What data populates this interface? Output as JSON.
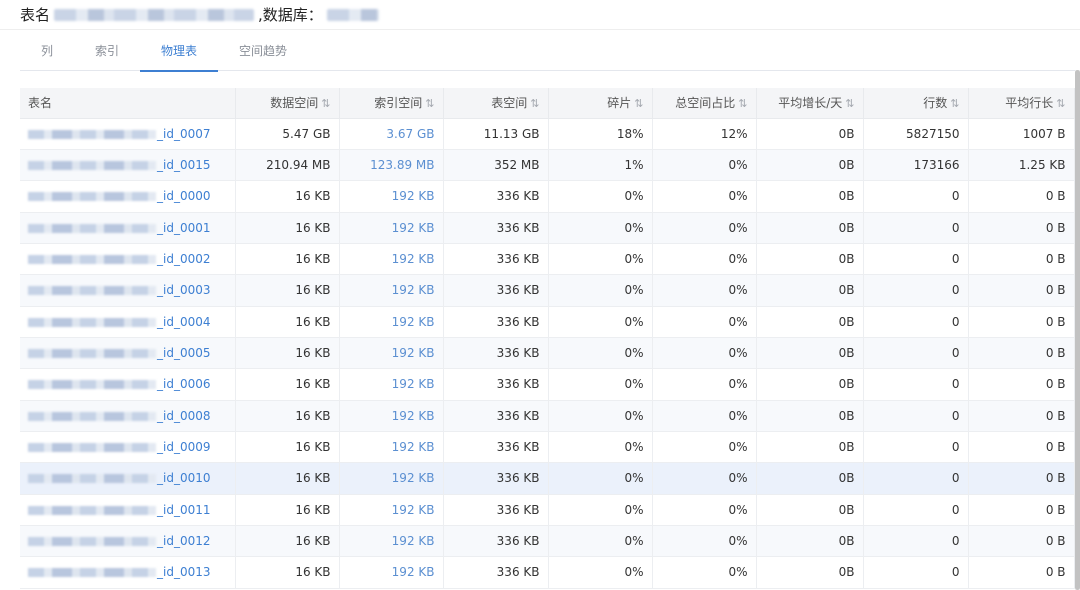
{
  "header": {
    "table_label": "表名",
    "db_label": ",数据库："
  },
  "tabs": [
    {
      "label": "列"
    },
    {
      "label": "索引"
    },
    {
      "label": "物理表",
      "active": true
    },
    {
      "label": "空间趋势"
    }
  ],
  "table": {
    "columns": [
      "表名",
      "数据空间",
      "索引空间",
      "表空间",
      "碎片",
      "总空间占比",
      "平均增长/天",
      "行数",
      "平均行长"
    ],
    "sort_icon": "⇅",
    "rows": [
      {
        "name": "_id_0007",
        "data": "5.47 GB",
        "index": "3.67 GB",
        "table": "11.13 GB",
        "frag": "18%",
        "ratio": "12%",
        "growth": "0B",
        "rows": "5827150",
        "avg": "1007 B"
      },
      {
        "name": "_id_0015",
        "data": "210.94 MB",
        "index": "123.89 MB",
        "table": "352 MB",
        "frag": "1%",
        "ratio": "0%",
        "growth": "0B",
        "rows": "173166",
        "avg": "1.25 KB"
      },
      {
        "name": "_id_0000",
        "data": "16 KB",
        "index": "192 KB",
        "table": "336 KB",
        "frag": "0%",
        "ratio": "0%",
        "growth": "0B",
        "rows": "0",
        "avg": "0 B"
      },
      {
        "name": "_id_0001",
        "data": "16 KB",
        "index": "192 KB",
        "table": "336 KB",
        "frag": "0%",
        "ratio": "0%",
        "growth": "0B",
        "rows": "0",
        "avg": "0 B"
      },
      {
        "name": "_id_0002",
        "data": "16 KB",
        "index": "192 KB",
        "table": "336 KB",
        "frag": "0%",
        "ratio": "0%",
        "growth": "0B",
        "rows": "0",
        "avg": "0 B"
      },
      {
        "name": "_id_0003",
        "data": "16 KB",
        "index": "192 KB",
        "table": "336 KB",
        "frag": "0%",
        "ratio": "0%",
        "growth": "0B",
        "rows": "0",
        "avg": "0 B"
      },
      {
        "name": "_id_0004",
        "data": "16 KB",
        "index": "192 KB",
        "table": "336 KB",
        "frag": "0%",
        "ratio": "0%",
        "growth": "0B",
        "rows": "0",
        "avg": "0 B"
      },
      {
        "name": "_id_0005",
        "data": "16 KB",
        "index": "192 KB",
        "table": "336 KB",
        "frag": "0%",
        "ratio": "0%",
        "growth": "0B",
        "rows": "0",
        "avg": "0 B"
      },
      {
        "name": "_id_0006",
        "data": "16 KB",
        "index": "192 KB",
        "table": "336 KB",
        "frag": "0%",
        "ratio": "0%",
        "growth": "0B",
        "rows": "0",
        "avg": "0 B"
      },
      {
        "name": "_id_0008",
        "data": "16 KB",
        "index": "192 KB",
        "table": "336 KB",
        "frag": "0%",
        "ratio": "0%",
        "growth": "0B",
        "rows": "0",
        "avg": "0 B"
      },
      {
        "name": "_id_0009",
        "data": "16 KB",
        "index": "192 KB",
        "table": "336 KB",
        "frag": "0%",
        "ratio": "0%",
        "growth": "0B",
        "rows": "0",
        "avg": "0 B"
      },
      {
        "name": "_id_0010",
        "data": "16 KB",
        "index": "192 KB",
        "table": "336 KB",
        "frag": "0%",
        "ratio": "0%",
        "growth": "0B",
        "rows": "0",
        "avg": "0 B",
        "highlight": true
      },
      {
        "name": "_id_0011",
        "data": "16 KB",
        "index": "192 KB",
        "table": "336 KB",
        "frag": "0%",
        "ratio": "0%",
        "growth": "0B",
        "rows": "0",
        "avg": "0 B"
      },
      {
        "name": "_id_0012",
        "data": "16 KB",
        "index": "192 KB",
        "table": "336 KB",
        "frag": "0%",
        "ratio": "0%",
        "growth": "0B",
        "rows": "0",
        "avg": "0 B"
      },
      {
        "name": "_id_0013",
        "data": "16 KB",
        "index": "192 KB",
        "table": "336 KB",
        "frag": "0%",
        "ratio": "0%",
        "growth": "0B",
        "rows": "0",
        "avg": "0 B"
      }
    ]
  },
  "colors": {
    "accent": "#3d7fd2",
    "link": "#5b8fd1",
    "header_bg": "#f4f5f7",
    "row_alt": "#f7f9fc",
    "row_highlight": "#ebf1fb"
  }
}
